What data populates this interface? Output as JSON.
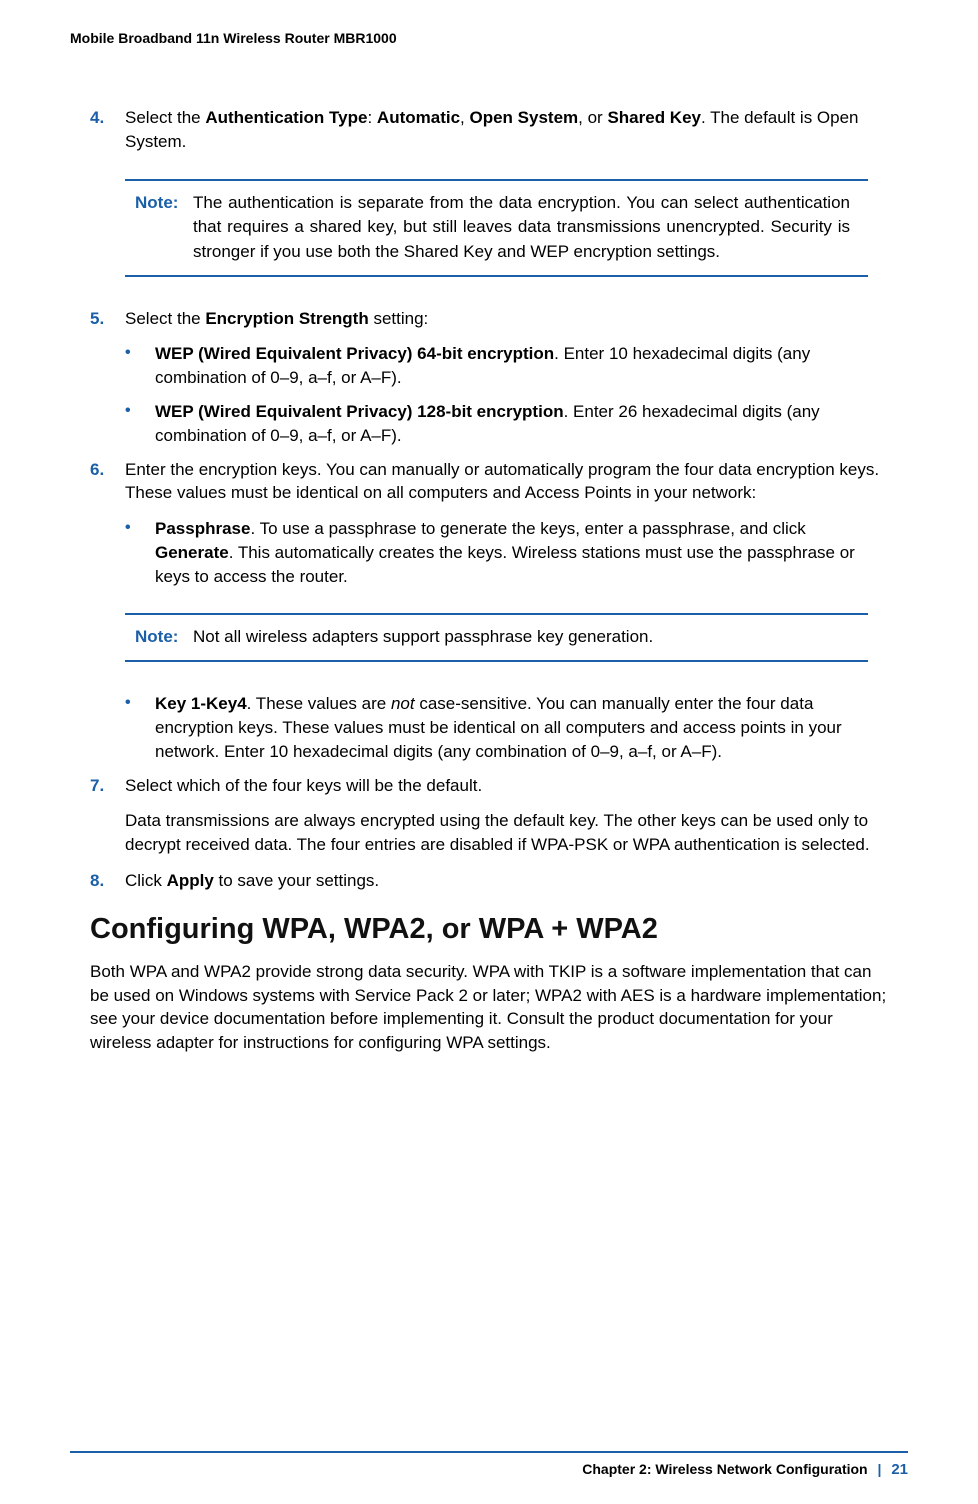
{
  "header": "Mobile Broadband 11n Wireless Router MBR1000",
  "step4": {
    "num": "4.",
    "text_before": "Select the ",
    "auth_type": "Authentication Type",
    "colon": ": ",
    "opt1": "Automatic",
    "sep1": ", ",
    "opt2": "Open System",
    "sep2": ", or ",
    "opt3": "Shared Key",
    "text_after": ". The default is Open System."
  },
  "note1": {
    "label": "Note:",
    "text": "The authentication is separate from the data encryption. You can select authentication that requires a shared key, but still leaves data transmissions unencrypted. Security is stronger if you use both the Shared Key and WEP encryption settings."
  },
  "step5": {
    "num": "5.",
    "text_before": "Select the ",
    "bold": "Encryption Strength",
    "text_after": " setting:"
  },
  "step5_b1": {
    "bold": "WEP (Wired Equivalent Privacy) 64-bit encryption",
    "text": ". Enter 10 hexadecimal digits (any combination of 0–9, a–f, or A–F)."
  },
  "step5_b2": {
    "bold": "WEP (Wired Equivalent Privacy) 128-bit encryption",
    "text": ". Enter 26 hexadecimal digits (any combination of 0–9, a–f, or A–F)."
  },
  "step6": {
    "num": "6.",
    "text": "Enter the encryption keys. You can manually or automatically program the four data encryption keys. These values must be identical on all computers and Access Points in your network:"
  },
  "step6_b1": {
    "bold1": "Passphrase",
    "text1": ". To use a passphrase to generate the keys, enter a passphrase, and click ",
    "bold2": "Generate",
    "text2": ". This automatically creates the keys. Wireless stations must use the passphrase or keys to access the router."
  },
  "note2": {
    "label": "Note:",
    "text": "Not all wireless adapters support passphrase key generation."
  },
  "step6_b2": {
    "bold": "Key 1-Key4",
    "text1": ". These values are ",
    "italic": "not",
    "text2": " case-sensitive. You can manually enter the four data encryption keys. These values must be identical on all computers and access points in your network. Enter 10 hexadecimal digits (any combination of 0–9, a–f, or A–F)."
  },
  "step7": {
    "num": "7.",
    "text": "Select which of the four keys will be the default.",
    "para": "Data transmissions are always encrypted using the default key. The other keys can be used only to decrypt received data. The four entries are disabled if WPA-PSK or WPA authentication is selected."
  },
  "step8": {
    "num": "8.",
    "text_before": "Click ",
    "bold": "Apply",
    "text_after": " to save your settings."
  },
  "heading": "Configuring WPA, WPA2, or WPA + WPA2",
  "section_para": "Both WPA and WPA2 provide strong data security. WPA with TKIP is a software implementation that can be used on Windows systems with Service Pack 2 or later; WPA2 with AES is a hardware implementation; see your device documentation before implementing it. Consult the product documentation for your wireless adapter for instructions for configuring WPA settings.",
  "footer": {
    "chapter": "Chapter 2:  Wireless Network Configuration",
    "sep": "|",
    "page": "21"
  },
  "bullet": "•"
}
